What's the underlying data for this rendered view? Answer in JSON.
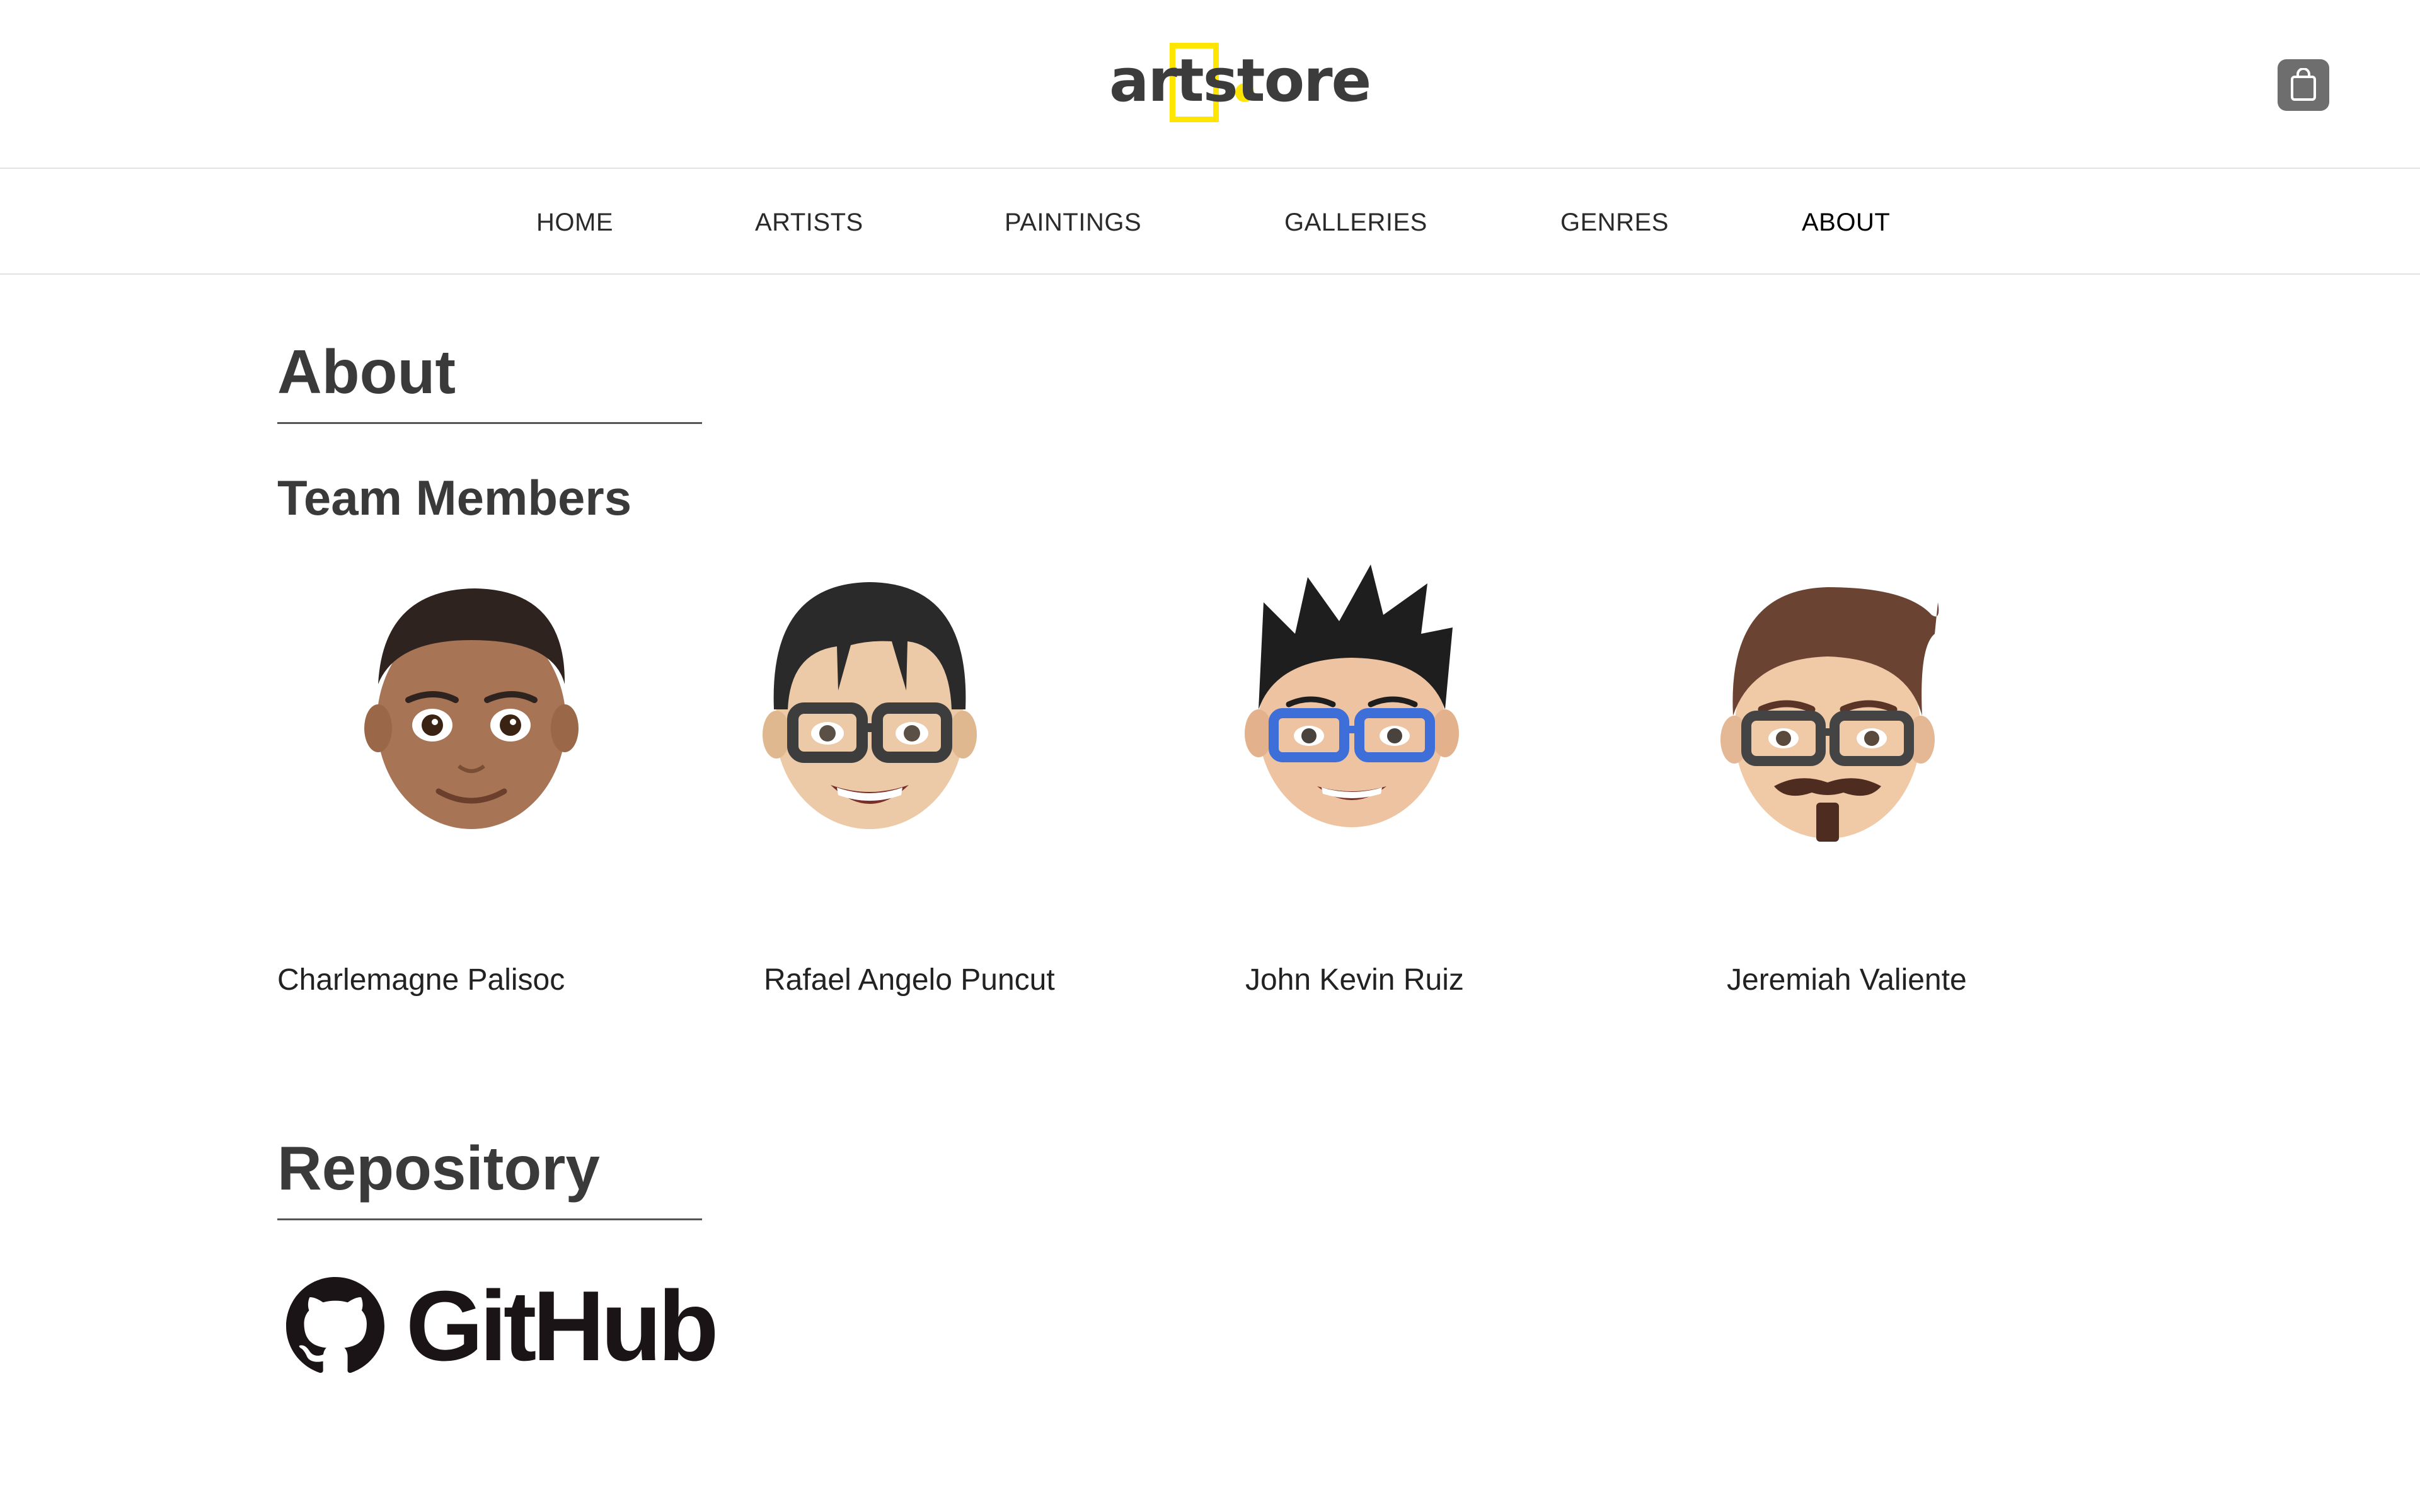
{
  "brand": {
    "logo_text": "artstore",
    "accent_color": "#ffe600"
  },
  "header": {
    "cart_icon": "shopping-bag-icon"
  },
  "nav": {
    "items": [
      {
        "label": "HOME"
      },
      {
        "label": "ARTISTS"
      },
      {
        "label": "PAINTINGS"
      },
      {
        "label": "GALLERIES"
      },
      {
        "label": "GENRES"
      },
      {
        "label": "ABOUT"
      }
    ]
  },
  "about": {
    "title": "About",
    "team_title": "Team Members",
    "members": [
      {
        "name": "Charlemagne Palisoc",
        "avatar_icon": "memoji-avatar-icon"
      },
      {
        "name": "Rafael Angelo Puncut",
        "avatar_icon": "memoji-avatar-icon"
      },
      {
        "name": "John Kevin Ruiz",
        "avatar_icon": "memoji-avatar-icon"
      },
      {
        "name": "Jeremiah Valiente",
        "avatar_icon": "memoji-avatar-icon"
      }
    ]
  },
  "repository": {
    "title": "Repository",
    "github_label": "GitHub",
    "github_icon": "github-octocat-icon"
  }
}
